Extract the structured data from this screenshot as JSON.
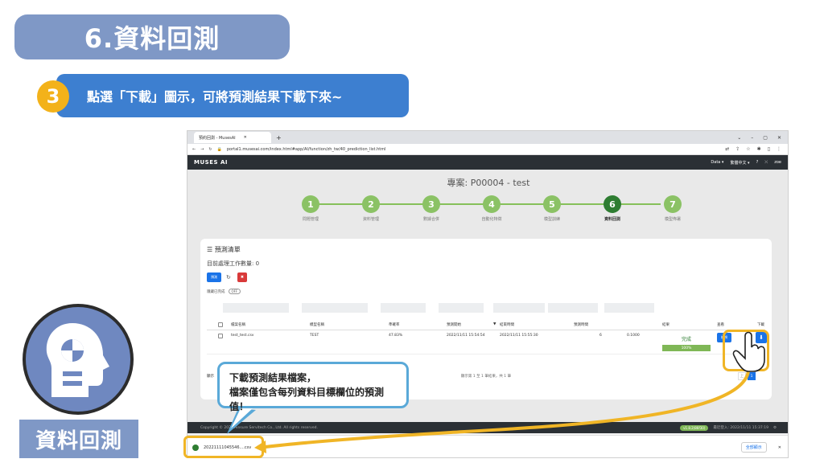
{
  "slide": {
    "title": "6.資料回測",
    "step_number": "3",
    "step_text": "點選「下載」圖示，可將預測結果下載下來~",
    "bottom_label": "資料回測",
    "callout_line1": "下載預測結果檔案，",
    "callout_line2": "檔案僅包含每列資料目標欄位的預測值！"
  },
  "browser": {
    "tab_title": "預約回測 - MusesAI",
    "url": "portal1.musesai.com/index.html#app/AI/function/zh_tw/40_prediction_list.html",
    "app_logo": "MUSES AI",
    "header_items": [
      "Data ▾",
      "繁體中文 ▾",
      "?",
      "⤫",
      "zoe"
    ]
  },
  "project": {
    "title": "專案: P00004 - test",
    "steps": [
      {
        "num": "1",
        "label": "問題管理"
      },
      {
        "num": "2",
        "label": "資料管理"
      },
      {
        "num": "3",
        "label": "數據合併"
      },
      {
        "num": "4",
        "label": "自動化特徵"
      },
      {
        "num": "5",
        "label": "模型訓練"
      },
      {
        "num": "6",
        "label": "資料回測"
      },
      {
        "num": "7",
        "label": "模型佈署"
      }
    ]
  },
  "prediction": {
    "card_title": "預測清單",
    "pending_text": "目前處理工作數量: 0",
    "new_button": "預測",
    "delete_button": "✖",
    "hide_done_label": "隱藏已完成",
    "toggle_label": "OFF",
    "columns": [
      "檔案名稱",
      "模型名稱",
      "準確率",
      "預測開始",
      "結束時間",
      "預測時間",
      "結果",
      "查看",
      "下載"
    ],
    "row": {
      "file": "test_test.csv",
      "model": "TEST",
      "accuracy": "47.83%",
      "start": "2022/11/11 15:54:54",
      "end": "2022/11/11 15:55:30",
      "duration": "6",
      "value": "0.1000",
      "status": "完成",
      "progress_label": "100%",
      "progress": 1.0,
      "view_button": "檢視",
      "download_icon": "⬇"
    },
    "pager_info": "顯示第 1 至 1 筆結果，共 1 筆",
    "pager_left": "顯示",
    "pager_prev": "上",
    "pager_current": "1"
  },
  "footer": {
    "copyright": "Copyright © 2022 Ainsure Servitech Co., Ltd. All rights reserved.",
    "version": "v1.8.2(86f30)",
    "last_login": "最近登入: 2022/11/11 15:37:19"
  },
  "download_bar": {
    "file": "20221111045546....csv",
    "show_all": "全部顯示",
    "close": "✕"
  },
  "colors": {
    "title_bg": "#7f98c6",
    "banner_bg": "#3d7fd0",
    "step_badge": "#f3b21a",
    "highlight": "#f0b526",
    "callout_border": "#5aa9d8",
    "step_done": "#8bc265",
    "step_active": "#2e7d32"
  }
}
